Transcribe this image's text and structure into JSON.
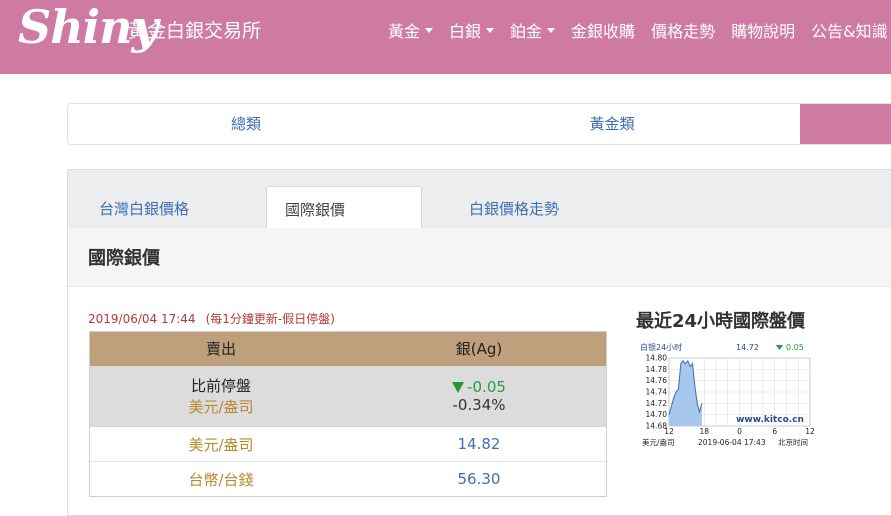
{
  "header": {
    "logo_script": "Shiny",
    "logo_sub": "黃金白銀交易所",
    "nav": [
      {
        "label": "黃金",
        "dropdown": true
      },
      {
        "label": "白銀",
        "dropdown": true
      },
      {
        "label": "鉑金",
        "dropdown": true
      },
      {
        "label": "金銀收購",
        "dropdown": false
      },
      {
        "label": "價格走勢",
        "dropdown": false
      },
      {
        "label": "購物說明",
        "dropdown": false
      },
      {
        "label": "公告&知識",
        "dropdown": false
      }
    ]
  },
  "categories": [
    "總類",
    "黃金類"
  ],
  "subtabs": [
    "台灣白銀價格",
    "國際銀價",
    "白銀價格走勢"
  ],
  "section_title": "國際銀價",
  "update": {
    "datetime": "2019/06/04 17:44",
    "note": "(每1分鐘更新-假日停盤)"
  },
  "table": {
    "headers": [
      "賣出",
      "銀(Ag)"
    ],
    "change_row": {
      "label1": "比前停盤",
      "label2": "美元/盎司",
      "change": "-0.05",
      "percent": "-0.34%"
    },
    "rows": [
      {
        "label": "美元/盎司",
        "value": "14.82"
      },
      {
        "label": "台幣/台錢",
        "value": "56.30"
      }
    ]
  },
  "chart_heading": "最近24小時國際盤價",
  "chart_data": {
    "type": "line",
    "title": "白银24小时",
    "current": "14.72",
    "change": "0.05",
    "ylim": [
      14.68,
      14.8
    ],
    "y_ticks": [
      "14.80",
      "14.78",
      "14.76",
      "14.74",
      "14.72",
      "14.70",
      "14.68"
    ],
    "x_ticks": [
      "12",
      "18",
      "0",
      "6",
      "12"
    ],
    "xlabel_left": "美元/盎司",
    "timestamp": "2019-06-04 17:43",
    "tz": "北京时间",
    "watermark": "www.kitco.cn",
    "series": [
      {
        "x": [
          0,
          0.4,
          0.8,
          1.2,
          1.6,
          2.0,
          2.4,
          2.8,
          3.2,
          3.6,
          4.0,
          4.4,
          4.8,
          5.2,
          5.6
        ],
        "values": [
          14.7,
          14.715,
          14.73,
          14.74,
          14.745,
          14.79,
          14.795,
          14.79,
          14.795,
          14.785,
          14.79,
          14.75,
          14.72,
          14.705,
          14.72
        ]
      }
    ],
    "colors": {
      "line": "#3a6db8",
      "fill": "#a9c6ec",
      "grid": "#cfcfcf"
    }
  }
}
